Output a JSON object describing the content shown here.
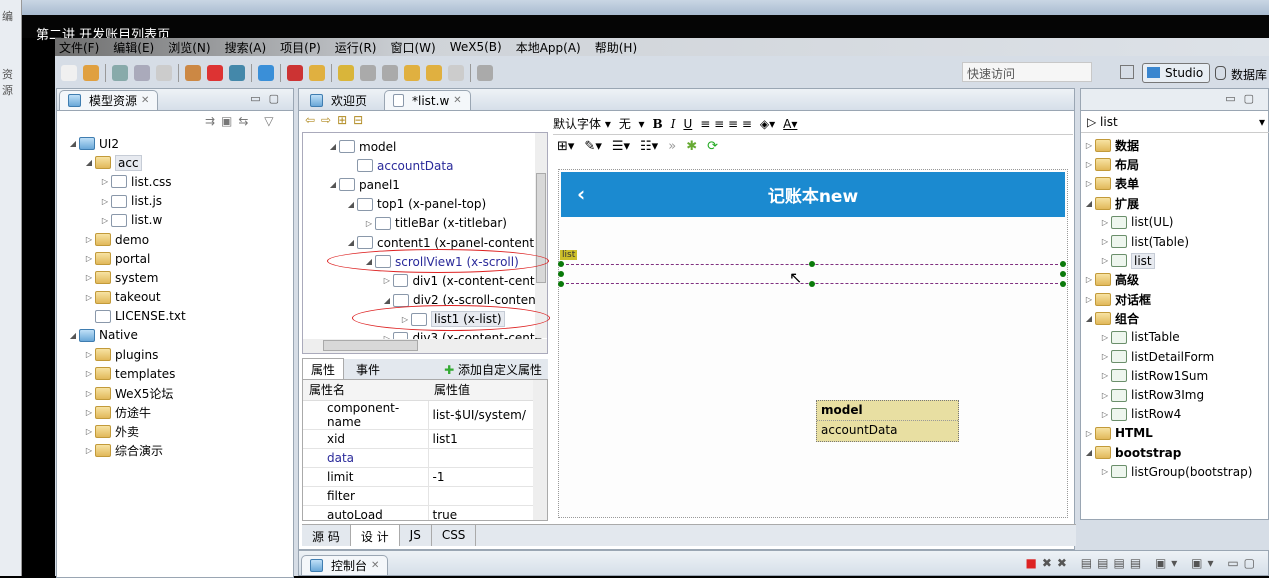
{
  "window": {
    "title": "第二讲 开发账目列表页"
  },
  "behind": {
    "labels": [
      "编",
      "资源"
    ]
  },
  "menu": [
    "文件(F)",
    "编辑(E)",
    "浏览(N)",
    "搜索(A)",
    "项目(P)",
    "运行(R)",
    "窗口(W)",
    "WeX5(B)",
    "本地App(A)",
    "帮助(H)"
  ],
  "toolbar": {
    "quick_access": "快速访问",
    "studio": "Studio",
    "database": "数据库"
  },
  "left_panel": {
    "tab": "模型资源",
    "tree": [
      {
        "label": "UI2",
        "level": 0,
        "icon": "project-icon",
        "open": true
      },
      {
        "label": "acc",
        "level": 1,
        "icon": "folder-icon",
        "open": true,
        "selected": true
      },
      {
        "label": "list.css",
        "level": 2,
        "icon": "css-file-icon"
      },
      {
        "label": "list.js",
        "level": 2,
        "icon": "js-file-icon"
      },
      {
        "label": "list.w",
        "level": 2,
        "icon": "w-file-icon"
      },
      {
        "label": "demo",
        "level": 1,
        "icon": "folder-icon"
      },
      {
        "label": "portal",
        "level": 1,
        "icon": "folder-icon"
      },
      {
        "label": "system",
        "level": 1,
        "icon": "folder-icon"
      },
      {
        "label": "takeout",
        "level": 1,
        "icon": "folder-icon"
      },
      {
        "label": "LICENSE.txt",
        "level": 1,
        "icon": "text-file-icon",
        "leaf": true
      },
      {
        "label": "Native",
        "level": 0,
        "icon": "project-icon",
        "open": true
      },
      {
        "label": "plugins",
        "level": 1,
        "icon": "folder-icon"
      },
      {
        "label": "templates",
        "level": 1,
        "icon": "folder-icon"
      },
      {
        "label": "WeX5论坛",
        "level": 1,
        "icon": "folder-icon"
      },
      {
        "label": "仿途牛",
        "level": 1,
        "icon": "folder-icon"
      },
      {
        "label": "外卖",
        "level": 1,
        "icon": "folder-icon"
      },
      {
        "label": "综合演示",
        "level": 1,
        "icon": "folder-icon"
      }
    ]
  },
  "editor": {
    "tabs": [
      "欢迎页",
      "*list.w"
    ],
    "outline": [
      {
        "label": "model",
        "level": 0,
        "open": true
      },
      {
        "label": "accountData",
        "level": 1,
        "leaf": true,
        "blue": true
      },
      {
        "label": "panel1",
        "level": 0,
        "open": true
      },
      {
        "label": "top1 (x-panel-top)",
        "level": 1,
        "open": true
      },
      {
        "label": "titleBar (x-titlebar)",
        "level": 2
      },
      {
        "label": "content1 (x-panel-content",
        "level": 1,
        "open": true
      },
      {
        "label": "scrollView1 (x-scroll)",
        "level": 2,
        "open": true,
        "blue": true
      },
      {
        "label": "div1 (x-content-cente",
        "level": 3
      },
      {
        "label": "div2 (x-scroll-conten",
        "level": 3,
        "open": true
      },
      {
        "label": "list1 (x-list)",
        "level": 4,
        "selected": true
      },
      {
        "label": "div3 (x-content-cente",
        "level": 3
      }
    ],
    "props_tabs": [
      "属性",
      "事件"
    ],
    "add_prop": "添加自定义属性",
    "props_header": [
      "属性名",
      "属性值"
    ],
    "props": [
      [
        "component-name",
        "list-$UI/system/"
      ],
      [
        "xid",
        "list1"
      ],
      [
        "data",
        ""
      ],
      [
        "limit",
        "-1"
      ],
      [
        "filter",
        ""
      ],
      [
        "autoLoad",
        "true"
      ]
    ],
    "bottom_tabs": [
      "源 码",
      "设 计",
      "JS",
      "CSS"
    ],
    "font": "默认字体",
    "size": "无",
    "canvas": {
      "title": "记账本new",
      "list_tag": "list",
      "model": "model",
      "data": "accountData"
    }
  },
  "palette": {
    "filter": "list",
    "items": [
      {
        "label": "数据",
        "level": 0,
        "bold": true
      },
      {
        "label": "布局",
        "level": 0,
        "bold": true
      },
      {
        "label": "表单",
        "level": 0,
        "bold": true
      },
      {
        "label": "扩展",
        "level": 0,
        "bold": true,
        "open": true
      },
      {
        "label": "list(UL)",
        "level": 1
      },
      {
        "label": "list(Table)",
        "level": 1
      },
      {
        "label": "list",
        "level": 1,
        "selected": true
      },
      {
        "label": "高级",
        "level": 0,
        "bold": true
      },
      {
        "label": "对话框",
        "level": 0,
        "bold": true
      },
      {
        "label": "组合",
        "level": 0,
        "bold": true,
        "open": true
      },
      {
        "label": "listTable",
        "level": 1
      },
      {
        "label": "listDetailForm",
        "level": 1
      },
      {
        "label": "listRow1Sum",
        "level": 1
      },
      {
        "label": "listRow3Img",
        "level": 1
      },
      {
        "label": "listRow4",
        "level": 1
      },
      {
        "label": "HTML",
        "level": 0,
        "bold": true
      },
      {
        "label": "bootstrap",
        "level": 0,
        "bold": true,
        "open": true
      },
      {
        "label": "listGroup(bootstrap)",
        "level": 1
      }
    ]
  },
  "console": {
    "tab": "控制台"
  }
}
